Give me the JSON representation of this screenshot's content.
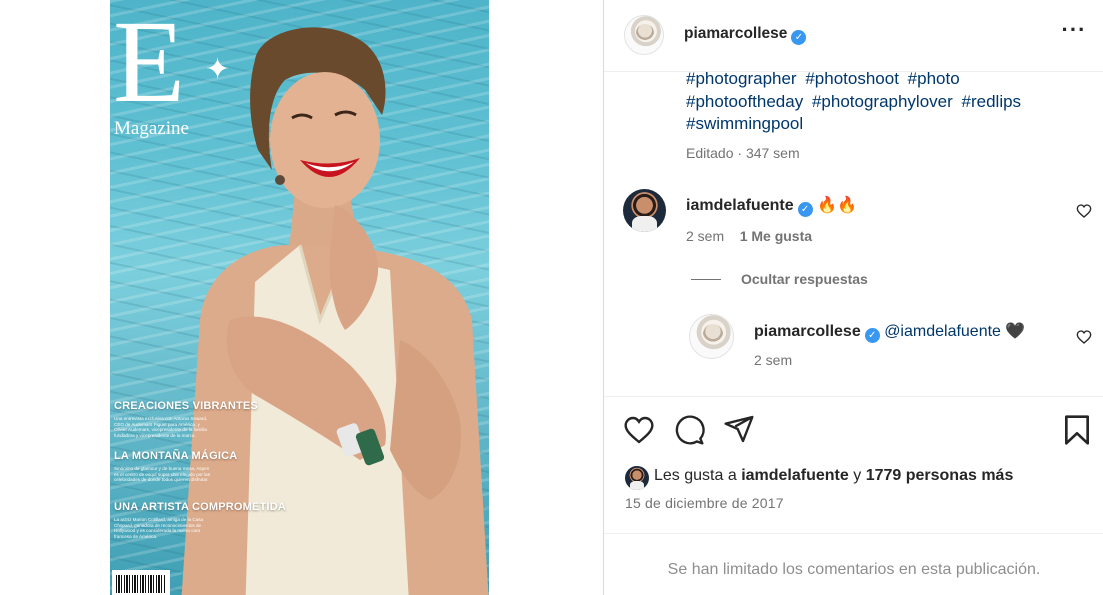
{
  "cover": {
    "logo_letter": "E",
    "logo_word": "Magazine",
    "sections": [
      {
        "heading": "CREACIONES VIBRANTES",
        "body": "Una entrevista exclusiva con Antonio Seward, CEO de Audemars Piguet para América, y Olivier Audemars, vicepresidente de la familia fundadora y vicepresidente de la marca."
      },
      {
        "heading": "LA MONTAÑA MÁGICA",
        "body": "Sinónimo de glamour y de buena mesa, Aspen es el centro de esquí super chic elegido por las celebridades de donde todos quieren disfrutar."
      },
      {
        "heading": "UNA ARTISTA COMPROMETIDA",
        "body": "La actriz Marion Cotillard, amiga de la Casa Chopard, ganadora de reconocimientos de Hollywood y es considerada la nueva cara francesa de América."
      }
    ]
  },
  "header": {
    "username": "piamarcollese",
    "verified_glyph": "✓",
    "more_glyph": "···"
  },
  "caption": {
    "hashtags": [
      "#photographer",
      "#photoshoot",
      "#photo",
      "#photooftheday",
      "#photographylover",
      "#redlips",
      "#swimmingpool"
    ],
    "edited": "Editado",
    "age": "347 sem"
  },
  "comments": [
    {
      "username": "iamdelafuente",
      "text": "🔥🔥",
      "age": "2 sem",
      "likes": "1 Me gusta",
      "hide_replies": "Ocultar respuestas",
      "replies": [
        {
          "username": "piamarcollese",
          "mention": "@iamdelafuente",
          "text": "🖤",
          "age": "2 sem"
        }
      ]
    }
  ],
  "actions": {
    "like": "heart-icon",
    "comment": "comment-icon",
    "share": "share-icon",
    "save": "bookmark-icon"
  },
  "likes": {
    "prefix": "Les gusta a",
    "user": "iamdelafuente",
    "conjunction": "y",
    "others": "1779 personas más"
  },
  "date": "15 de diciembre de 2017",
  "comments_limited": "Se han limitado los comentarios en esta publicación.",
  "colors": {
    "link": "#00376b",
    "verified": "#3897f0",
    "muted": "#737373",
    "text": "#262626"
  }
}
